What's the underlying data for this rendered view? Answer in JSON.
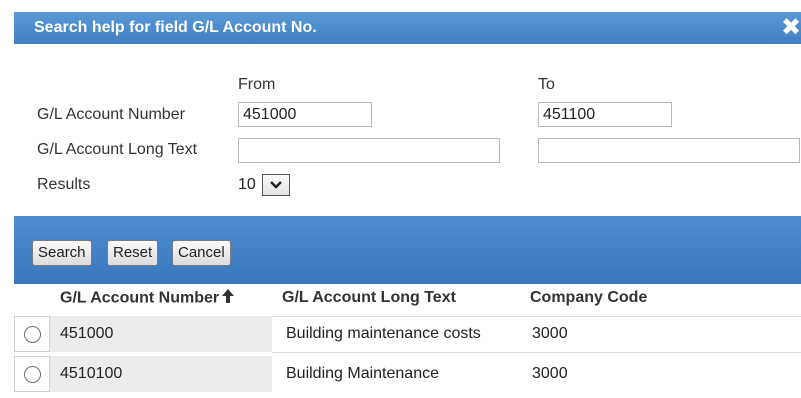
{
  "dialog": {
    "title": "Search help for field G/L Account No.",
    "close_icon": "close-x-icon"
  },
  "form": {
    "from_label": "From",
    "to_label": "To",
    "fields": [
      {
        "label": "G/L Account Number",
        "from_value": "451000",
        "to_value": "451100"
      },
      {
        "label": "G/L Account Long Text",
        "from_value": "",
        "to_value": ""
      }
    ],
    "results_label": "Results",
    "results_value": "10"
  },
  "toolbar": {
    "search_label": "Search",
    "reset_label": "Reset",
    "cancel_label": "Cancel"
  },
  "table": {
    "columns": [
      "G/L Account Number",
      "G/L Account Long Text",
      "Company Code"
    ],
    "sort_icon": "sort-ascending-arrow-icon",
    "rows": [
      {
        "account": "451000",
        "long_text": "Building maintenance costs",
        "company_code": "3000"
      },
      {
        "account": "4510100",
        "long_text": "Building Maintenance",
        "company_code": "3000"
      }
    ]
  },
  "colors": {
    "title_bar": "#4a8ccf",
    "toolbar": "#4483c8",
    "selected_column_bg": "#ececec"
  }
}
